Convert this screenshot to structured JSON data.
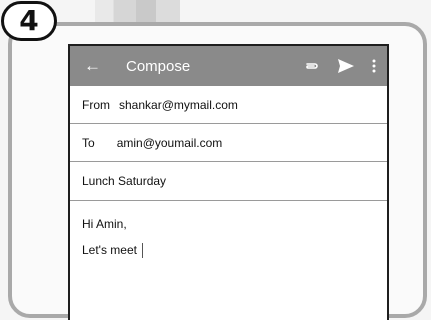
{
  "step": {
    "number": "4"
  },
  "appbar": {
    "title": "Compose",
    "background": "#8a8a8a",
    "icons": [
      "back-arrow-icon",
      "paperclip-icon",
      "send-icon",
      "more-vert-icon"
    ]
  },
  "from": {
    "label": "From",
    "value": "shankar@mymail.com"
  },
  "to": {
    "label": "To",
    "value": "amin@youmail.com"
  },
  "subject": {
    "value": "Lunch Saturday"
  },
  "body": {
    "line1": "Hi Amin,",
    "line2": "Let's meet"
  }
}
